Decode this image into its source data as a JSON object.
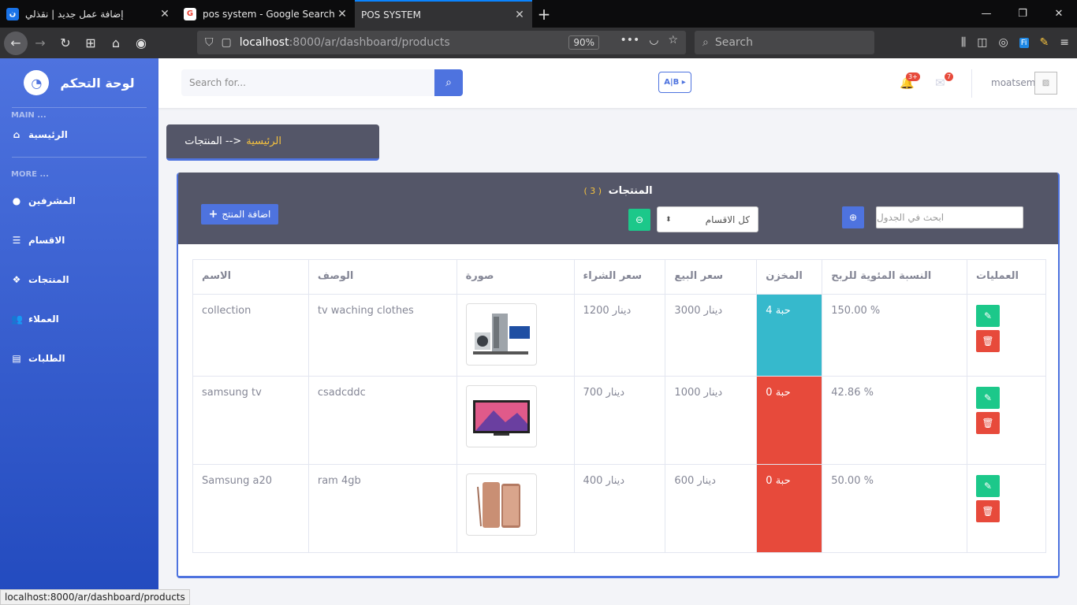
{
  "browser": {
    "tabs": [
      {
        "title": "إضافة عمل جديد | نقذلي",
        "favicon": "ن",
        "fav_color": "#1a73e8"
      },
      {
        "title": "pos system - Google Search",
        "favicon": "G",
        "fav_color": "#ea4335"
      },
      {
        "title": "POS SYSTEM",
        "favicon": "",
        "fav_color": ""
      }
    ],
    "url_host": "localhost",
    "url_path": ":8000/ar/dashboard/products",
    "zoom": "90%",
    "search_placeholder": "Search",
    "status_url": "localhost:8000/ar/dashboard/products"
  },
  "sidebar": {
    "brand": "لوحة التحكم",
    "heading_main": "MAIN ...",
    "heading_more": "MORE ...",
    "items": [
      {
        "label": "الرئيسية",
        "icon": "home-icon"
      },
      {
        "label": "المشرفين",
        "icon": "user-circle-icon"
      },
      {
        "label": "الاقسام",
        "icon": "list-icon"
      },
      {
        "label": "المنتجات",
        "icon": "box-icon"
      },
      {
        "label": "العملاء",
        "icon": "users-icon"
      },
      {
        "label": "الطلبات",
        "icon": "receipt-icon"
      }
    ]
  },
  "topbar": {
    "search_placeholder": "Search for...",
    "alerts_badge": "3+",
    "messages_badge": "7",
    "username": "moatsem"
  },
  "breadcrumb": {
    "current": "المنتجات -->",
    "home": "الرئيسية"
  },
  "card": {
    "title": "المنتجات",
    "count": "( 3 )",
    "add_label": "اضافة المنتج",
    "category_select": "كل الاقسام",
    "table_search_placeholder": "ابحث في الجدول"
  },
  "table": {
    "headers": [
      "الاسم",
      "الوصف",
      "صورة",
      "سعر الشراء",
      "سعر البيع",
      "المخزن",
      "النسبة المئوية للربح",
      "العمليات"
    ],
    "rows": [
      {
        "name": "collection",
        "desc": "tv waching clothes",
        "buy": "1200 دينار",
        "sell": "3000 دينار",
        "stock": "4 حبة",
        "stock_status": "ok",
        "profit": "150.00 %"
      },
      {
        "name": "samsung tv",
        "desc": "csadcddc",
        "buy": "700 دينار",
        "sell": "1000 دينار",
        "stock": "0 حبة",
        "stock_status": "out",
        "profit": "42.86 %"
      },
      {
        "name": "Samsung a20",
        "desc": "ram 4gb",
        "buy": "400 دينار",
        "sell": "600 دينار",
        "stock": "0 حبة",
        "stock_status": "out",
        "profit": "50.00 %"
      }
    ]
  },
  "colors": {
    "primary": "#4e73df",
    "success": "#1cc88a",
    "danger": "#e74a3b",
    "info": "#36b9cc",
    "header_dark": "#545668",
    "accent_yellow": "#f6c23e"
  }
}
